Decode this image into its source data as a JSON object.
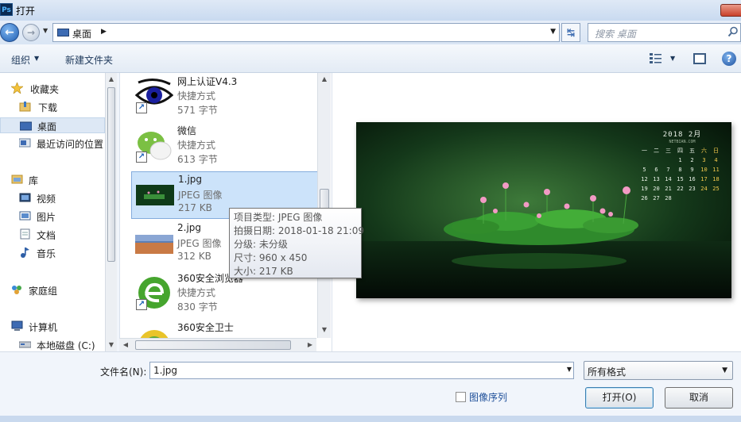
{
  "window": {
    "title": "打开",
    "app_icon_text": "Ps"
  },
  "address": {
    "location": "桌面",
    "search_placeholder": "搜索 桌面"
  },
  "toolbar": {
    "organize": "组织",
    "new_folder": "新建文件夹"
  },
  "nav": {
    "favorites": "收藏夹",
    "downloads": "下载",
    "desktop": "桌面",
    "recent": "最近访问的位置",
    "libraries": "库",
    "videos": "视频",
    "pictures": "图片",
    "documents": "文档",
    "music": "音乐",
    "homegroup": "家庭组",
    "computer": "计算机",
    "local_disk": "本地磁盘 (C:)"
  },
  "files": [
    {
      "name": "网上认证V4.3",
      "type": "快捷方式",
      "size": "571 字节"
    },
    {
      "name": "微信",
      "type": "快捷方式",
      "size": "613 字节"
    },
    {
      "name": "1.jpg",
      "type": "JPEG 图像",
      "size": "217 KB"
    },
    {
      "name": "2.jpg",
      "type": "JPEG 图像",
      "size": "312 KB"
    },
    {
      "name": "360安全浏览器",
      "type": "快捷方式",
      "size": "830 字节"
    },
    {
      "name": "360安全卫士",
      "type": "",
      "size": ""
    }
  ],
  "tooltip": {
    "type": "项目类型: JPEG 图像",
    "date": "拍摄日期: 2018-01-18 21:09",
    "rating": "分级: 未分级",
    "dimensions": "尺寸: 960 x 450",
    "size": "大小: 217 KB"
  },
  "preview": {
    "cal_title": "2018 2月",
    "cal_site": "NETBIAN.COM",
    "cal_days": [
      "一",
      "二",
      "三",
      "四",
      "五",
      "六",
      "日",
      "",
      "",
      "",
      "1",
      "2",
      "3",
      "4",
      "5",
      "6",
      "7",
      "8",
      "9",
      "10",
      "11",
      "12",
      "13",
      "14",
      "15",
      "16",
      "17",
      "18",
      "19",
      "20",
      "21",
      "22",
      "23",
      "24",
      "25",
      "26",
      "27",
      "28",
      "",
      "",
      "",
      ""
    ]
  },
  "bottom": {
    "filename_label": "文件名(N):",
    "filename_value": "1.jpg",
    "filter_value": "所有格式",
    "sequence_label": "图像序列",
    "open_button": "打开(O)",
    "cancel_button": "取消"
  },
  "colors": {
    "selection": "#cce3fa",
    "titlebar": "#c9daf0",
    "accent": "#3c7fb1"
  }
}
